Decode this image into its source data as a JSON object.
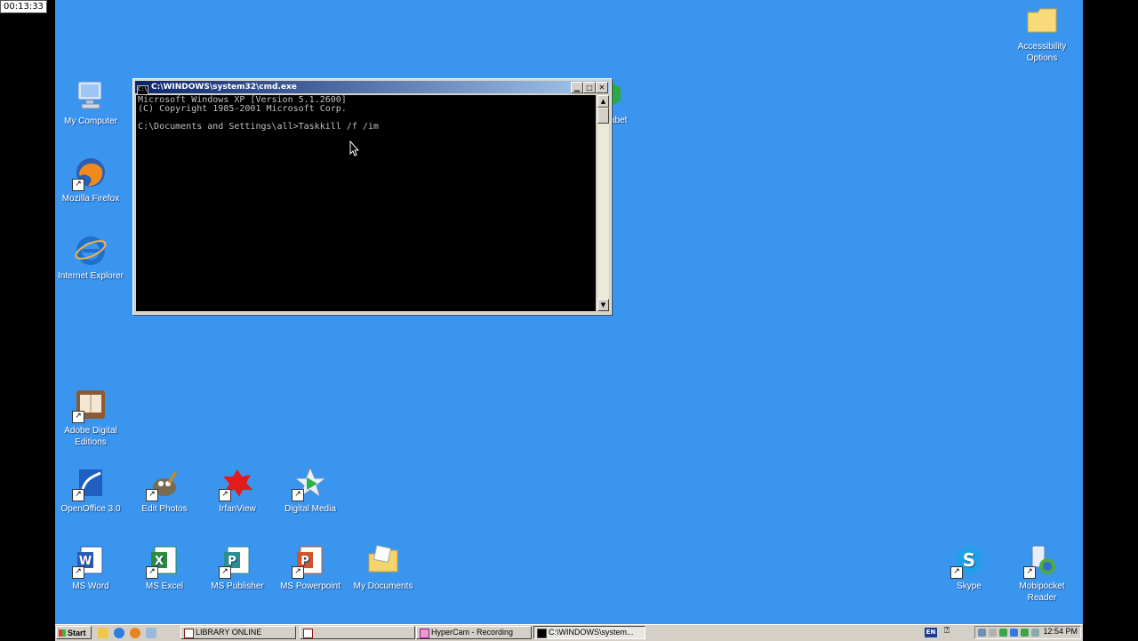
{
  "recording_timer": "00:13:33",
  "desktop": {
    "icons": {
      "my_computer": "My Computer",
      "mozilla_firefox": "Mozilla Firefox",
      "internet_explorer": "Internet Explorer",
      "adobe_digital_editions": "Adobe Digital Editions",
      "openoffice": "OpenOffice 3.0",
      "edit_photos": "Edit Photos",
      "irfanview": "IrfanView",
      "digital_media": "Digital Media",
      "ms_word": "MS Word",
      "ms_excel": "MS Excel",
      "ms_publisher": "MS Publisher",
      "ms_powerpoint": "MS Powerpoint",
      "my_documents": "My Documents",
      "skype": "Skype",
      "mobipocket_reader": "Mobipocket Reader",
      "accessibility_options": "Accessibility Options",
      "partial_label": "abet"
    }
  },
  "cmd_window": {
    "title": "C:\\WINDOWS\\system32\\cmd.exe",
    "system_icon": "C:\\",
    "minimize": "▁",
    "maximize": "□",
    "close": "✕",
    "console_text": "Microsoft Windows XP [Version 5.1.2600]\n(C) Copyright 1985-2001 Microsoft Corp.\n\nC:\\Documents and Settings\\all>Taskkill /f /im",
    "scroll_up": "▲",
    "scroll_down": "▼"
  },
  "taskbar": {
    "start_label": "Start",
    "tasks": {
      "library_online": "LIBRARY ONLINE",
      "hypercam": "HyperCam - Recording",
      "cmd": "C:\\WINDOWS\\system..."
    },
    "language": "EN",
    "help": "⍰",
    "clock": "12:54 PM"
  },
  "colors": {
    "desktop": "#3a95ee",
    "titlebar_start": "#0a246a",
    "titlebar_end": "#a6caf0",
    "console_bg": "#000000",
    "console_text": "#c0c0c0"
  }
}
